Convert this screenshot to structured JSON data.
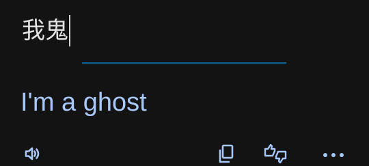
{
  "input": {
    "source_text": "我鬼"
  },
  "output": {
    "translation_text": "I'm a ghost"
  },
  "toolbar": {
    "listen_icon": "speaker-icon",
    "copy_icon": "copy-icon",
    "rate_icon": "thumbs-up-down-icon",
    "more_icon": "more-horizontal-icon"
  },
  "colors": {
    "background": "#131314",
    "source_text": "#e3e3e3",
    "translation_text": "#a8c7fa",
    "divider": "#0e4f72",
    "icon": "#a8c7fa"
  }
}
